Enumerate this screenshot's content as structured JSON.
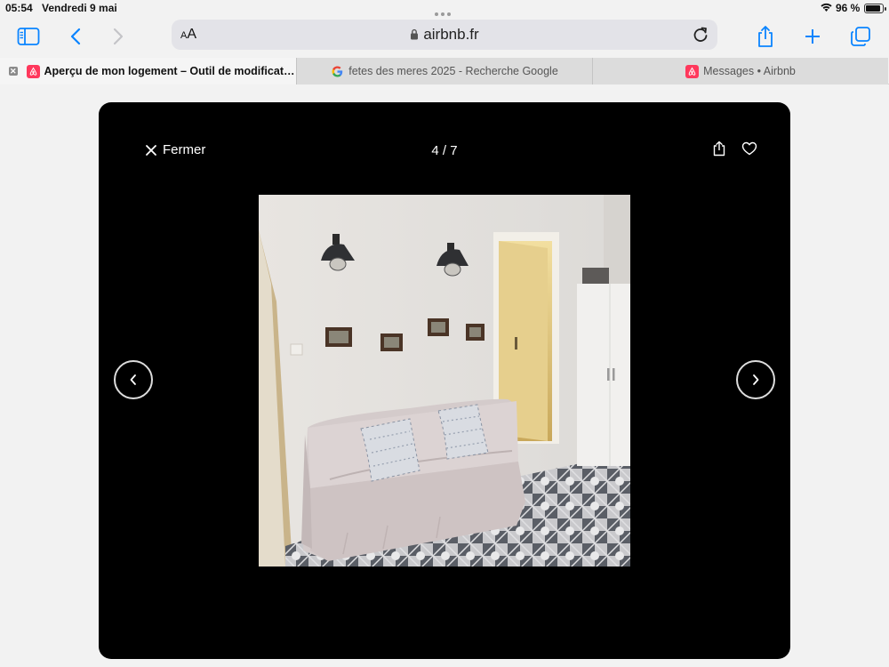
{
  "status_bar": {
    "time": "05:54",
    "date": "Vendredi 9 mai",
    "battery_percent": "96 %",
    "battery_level": 0.96
  },
  "address_bar": {
    "reader_label": "AA",
    "url": "airbnb.fr"
  },
  "tabs": [
    {
      "title": "Aperçu de mon logement – Outil de modification...",
      "favicon": "airbnb-icon",
      "active": true
    },
    {
      "title": "fetes des meres 2025 - Recherche Google",
      "favicon": "google-icon",
      "active": false
    },
    {
      "title": "Messages • Airbnb",
      "favicon": "airbnb-icon",
      "active": false
    }
  ],
  "viewer": {
    "close_label": "Fermer",
    "counter": "4 / 7",
    "photo_index": 4,
    "photo_total": 7
  },
  "colors": {
    "airbnb_brand": "#ff385c",
    "safari_accent": "#0a84ff",
    "viewer_background": "#000000"
  }
}
